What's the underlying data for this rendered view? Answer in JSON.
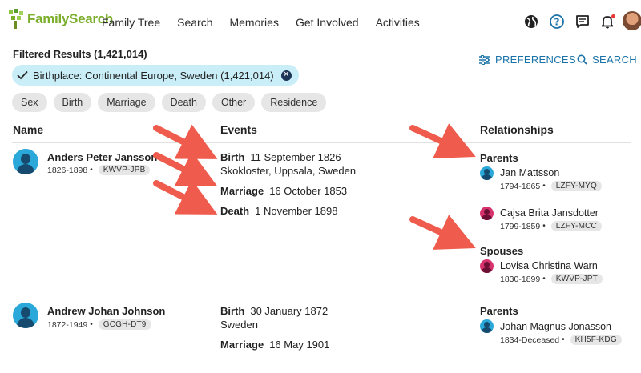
{
  "app": {
    "brand": "FamilySearch"
  },
  "nav": [
    "Family Tree",
    "Search",
    "Memories",
    "Get Involved",
    "Activities"
  ],
  "results": {
    "label": "Filtered Results (1,421,014)"
  },
  "actions": {
    "preferences": "PREFERENCES",
    "search": "SEARCH"
  },
  "active_filter": "Birthplace: Continental Europe, Sweden (1,421,014)",
  "filter_chips": [
    "Sex",
    "Birth",
    "Marriage",
    "Death",
    "Other",
    "Residence"
  ],
  "columns": {
    "name": "Name",
    "events": "Events",
    "relationships": "Relationships"
  },
  "records": [
    {
      "name": "Anders Peter Jansson",
      "dates": "1826-1898",
      "id": "KWVP-JPB",
      "events": [
        {
          "type": "Birth",
          "date": "11 September 1826",
          "place": "Skokloster, Uppsala, Sweden"
        },
        {
          "type": "Marriage",
          "date": "16 October 1853"
        },
        {
          "type": "Death",
          "date": "1 November 1898"
        }
      ],
      "parents_label": "Parents",
      "parents": [
        {
          "name": "Jan Mattsson",
          "dates": "1794-1865",
          "id": "LZFY-MYQ"
        },
        {
          "name": "Cajsa Brita Jansdotter",
          "dates": "1799-1859",
          "id": "LZFY-MCC"
        }
      ],
      "spouses_label": "Spouses",
      "spouses": [
        {
          "name": "Lovisa Christina Warn",
          "dates": "1830-1899",
          "id": "KWVP-JPT"
        }
      ]
    },
    {
      "name": "Andrew Johan Johnson",
      "dates": "1872-1949",
      "id": "GCGH-DT9",
      "events": [
        {
          "type": "Birth",
          "date": "30 January 1872",
          "place": "Sweden"
        },
        {
          "type": "Marriage",
          "date": "16 May 1901"
        }
      ],
      "parents_label": "Parents",
      "parents": [
        {
          "name": "Johan Magnus Jonasson",
          "dates": "1834-Deceased",
          "id": "KH5F-KDG"
        }
      ]
    }
  ],
  "colors": {
    "accent": "#1a73a8",
    "brand": "#7bae2a",
    "chip_active": "#c9eef8",
    "annotation_arrow": "#ef5b4c"
  },
  "icons": [
    "globe-icon",
    "help-icon",
    "messages-icon",
    "bell-icon",
    "user-avatar",
    "sliders-icon",
    "search-icon",
    "check-icon",
    "close-icon"
  ]
}
